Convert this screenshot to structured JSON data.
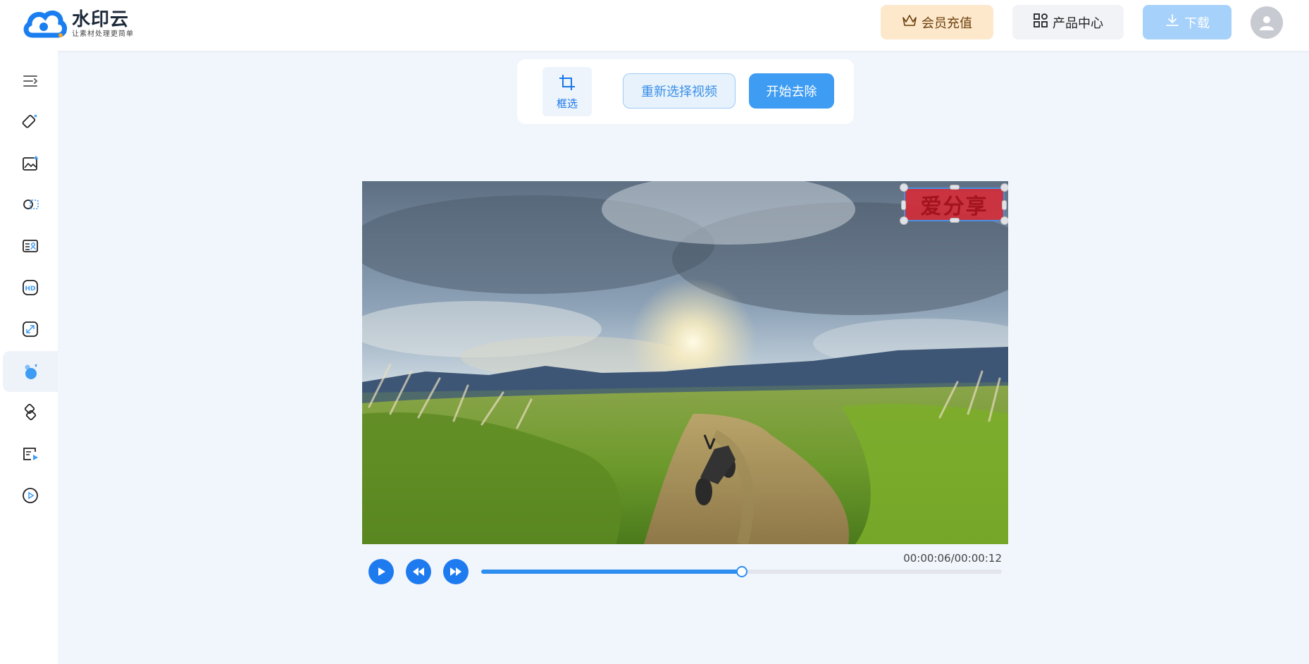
{
  "header": {
    "logo_title": "水印云",
    "logo_sub": "让素材处理更简单",
    "vip_label": "会员充值",
    "products_label": "产品中心",
    "download_label": "下载"
  },
  "sidebar": {
    "items": [
      {
        "icon": "menu-collapse-icon"
      },
      {
        "icon": "eraser-icon"
      },
      {
        "icon": "image-edit-icon"
      },
      {
        "icon": "cutout-icon"
      },
      {
        "icon": "id-card-icon"
      },
      {
        "icon": "hd-icon"
      },
      {
        "icon": "resize-icon"
      },
      {
        "icon": "video-watermark-icon",
        "active": true
      },
      {
        "icon": "link-icon"
      },
      {
        "icon": "video-edit-icon"
      },
      {
        "icon": "play-circle-icon"
      }
    ]
  },
  "toolbar": {
    "select_label": "框选",
    "reselect_label": "重新选择视频",
    "start_label": "开始去除"
  },
  "video": {
    "watermark_text": "爱分享"
  },
  "player": {
    "time": "00:00:06/00:00:12",
    "progress": 0.5
  },
  "colors": {
    "accent": "#1e7bef",
    "vip_bg": "#fde8cc",
    "download_bg": "#a6d1fb"
  }
}
